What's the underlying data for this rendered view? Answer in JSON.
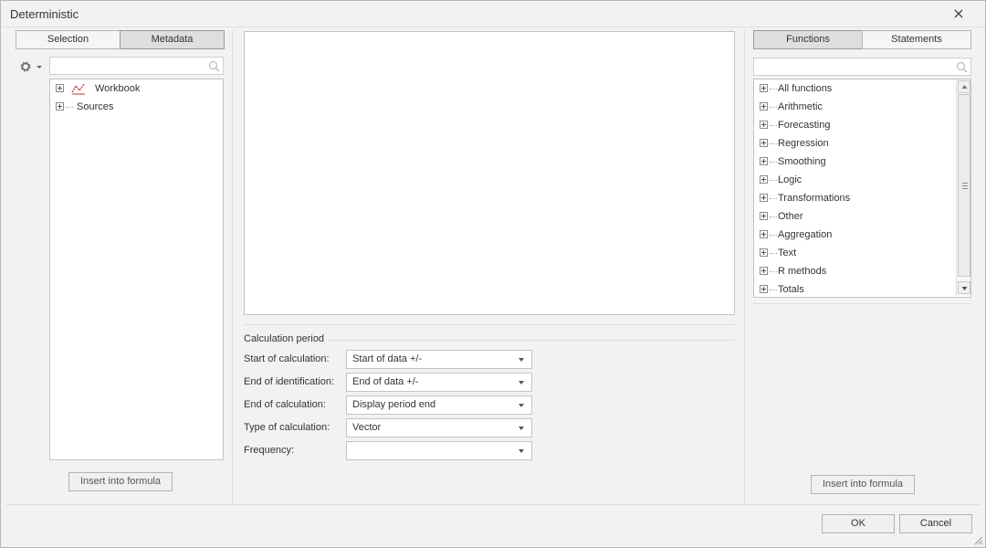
{
  "window": {
    "title": "Deterministic"
  },
  "left": {
    "tabs": {
      "selection": "Selection",
      "metadata": "Metadata"
    },
    "search": {
      "placeholder": ""
    },
    "tree": [
      {
        "label": "Workbook"
      },
      {
        "label": "Sources"
      }
    ],
    "insert_label": "Insert into formula"
  },
  "center": {
    "group_title": "Calculation period",
    "fields": [
      {
        "label": "Start of calculation:",
        "value": "Start of data +/-"
      },
      {
        "label": "End of identification:",
        "value": "End of data +/-"
      },
      {
        "label": "End of calculation:",
        "value": "Display period end"
      },
      {
        "label": "Type of calculation:",
        "value": "Vector"
      },
      {
        "label": "Frequency:",
        "value": ""
      }
    ]
  },
  "right": {
    "tabs": {
      "functions": "Functions",
      "statements": "Statements"
    },
    "search": {
      "placeholder": ""
    },
    "functions": [
      "All functions",
      "Arithmetic",
      "Forecasting",
      "Regression",
      "Smoothing",
      "Logic",
      "Transformations",
      "Other",
      "Aggregation",
      "Text",
      "R methods",
      "Totals"
    ],
    "insert_label": "Insert into formula"
  },
  "footer": {
    "ok_label": "OK",
    "cancel_label": "Cancel"
  },
  "colors": {
    "workbook_icon": "#c0392b",
    "active_tab": "#dedede"
  }
}
